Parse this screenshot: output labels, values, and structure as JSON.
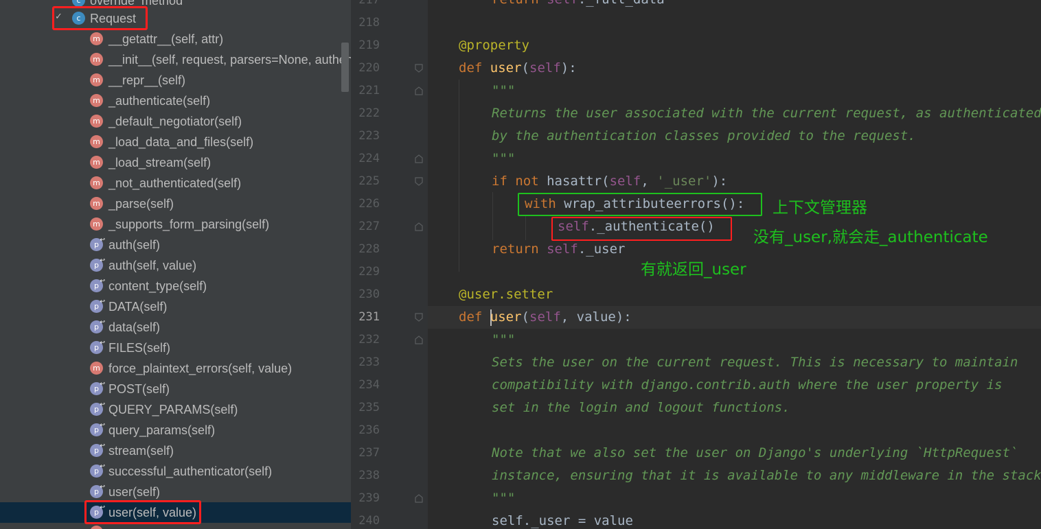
{
  "structure": {
    "top_partial_label": "override_method",
    "class_item": {
      "icon": "c",
      "label": "Request"
    },
    "bottom_partial_label": "",
    "items": [
      {
        "kind": "m",
        "label": "__getattr__(self, attr)"
      },
      {
        "kind": "m",
        "label": "__init__(self, request, parsers=None, authenticators=None, negotiator=None, parser_context=None)"
      },
      {
        "kind": "m",
        "label": "__repr__(self)"
      },
      {
        "kind": "m",
        "label": "_authenticate(self)"
      },
      {
        "kind": "m",
        "label": "_default_negotiator(self)"
      },
      {
        "kind": "m",
        "label": "_load_data_and_files(self)"
      },
      {
        "kind": "m",
        "label": "_load_stream(self)"
      },
      {
        "kind": "m",
        "label": "_not_authenticated(self)"
      },
      {
        "kind": "m",
        "label": "_parse(self)"
      },
      {
        "kind": "m",
        "label": "_supports_form_parsing(self)"
      },
      {
        "kind": "p",
        "label": "auth(self)"
      },
      {
        "kind": "p",
        "label": "auth(self, value)"
      },
      {
        "kind": "p",
        "label": "content_type(self)"
      },
      {
        "kind": "p",
        "label": "DATA(self)"
      },
      {
        "kind": "p",
        "label": "data(self)"
      },
      {
        "kind": "p",
        "label": "FILES(self)"
      },
      {
        "kind": "m",
        "label": "force_plaintext_errors(self, value)"
      },
      {
        "kind": "p",
        "label": "POST(self)"
      },
      {
        "kind": "p",
        "label": "QUERY_PARAMS(self)"
      },
      {
        "kind": "p",
        "label": "query_params(self)"
      },
      {
        "kind": "p",
        "label": "stream(self)"
      },
      {
        "kind": "p",
        "label": "successful_authenticator(self)"
      },
      {
        "kind": "p",
        "label": "user(self)"
      },
      {
        "kind": "p",
        "label": "user(self, value)"
      }
    ]
  },
  "editor": {
    "line_numbers": [
      "217",
      "218",
      "219",
      "220",
      "221",
      "222",
      "223",
      "224",
      "225",
      "226",
      "227",
      "228",
      "229",
      "230",
      "231",
      "232",
      "233",
      "234",
      "235",
      "236",
      "237",
      "238",
      "239",
      "240"
    ],
    "current_line": "231",
    "code": {
      "l217": "return self._full_data",
      "l219_decorator": "@property",
      "l220_def": "def",
      "l220_name": "user",
      "l220_self": "self",
      "quotes": "\"\"\"",
      "l222": "Returns the user associated with the current request, as authenticated",
      "l223": "by the authentication classes provided to the request.",
      "l225_if": "if not",
      "l225_call": "hasattr(",
      "l225_self": "self",
      "l225_str": "'_user'",
      "l226_with": "with",
      "l226_rest": "wrap_attributeerrors():",
      "l227_self": "self",
      "l227_rest": "._authenticate()",
      "l228_return": "return",
      "l228_self": "self",
      "l228_rest": "._user",
      "l230_decorator": "@user.setter",
      "l231_def": "def",
      "l231_name": "user",
      "l231_self": "self",
      "l231_rest": ", value):",
      "l233": "Sets the user on the current request. This is necessary to maintain",
      "l234": "compatibility with django.contrib.auth where the user property is",
      "l235": "set in the login and logout functions.",
      "l237": "Note that we also set the user on Django's underlying `HttpRequest`",
      "l238": "instance, ensuring that it is available to any middleware in the stack.",
      "l240": "self._user = value"
    }
  },
  "annotations": {
    "context_manager": "上下文管理器",
    "no_user": "没有_user,就会走_authenticate",
    "has_user": "有就返回_user"
  },
  "colors": {
    "red_box": "#ff1f1f",
    "green_box": "#1ec01e",
    "annotation_text": "#1ec01e"
  }
}
